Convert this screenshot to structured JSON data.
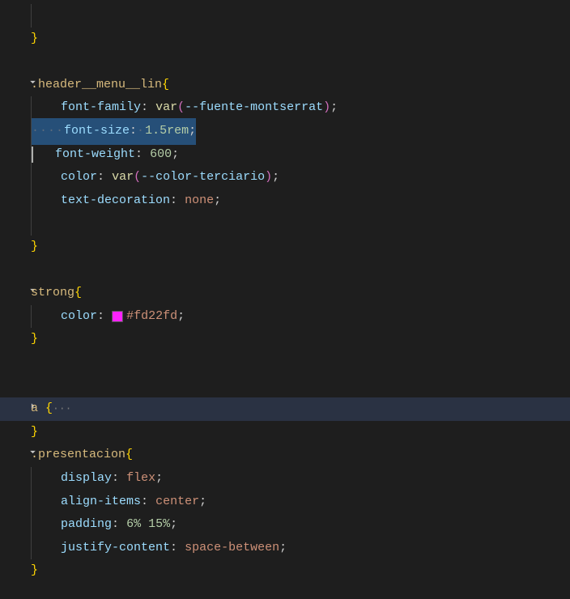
{
  "rules": {
    "headerMenuLin": {
      "selector": ".header__menu__lin",
      "props": {
        "fontFamily": {
          "name": "font-family",
          "func": "var",
          "arg": "--fuente-montserrat"
        },
        "fontSize": {
          "name": "font-size",
          "value": "1.5rem",
          "raw": "font-size: 1.5rem;"
        },
        "fontWeight": {
          "name": "font-weight",
          "value": "600"
        },
        "color": {
          "name": "color",
          "func": "var",
          "arg": "--color-terciario"
        },
        "textDecoration": {
          "name": "text-decoration",
          "value": "none"
        }
      }
    },
    "strong": {
      "selector": "strong",
      "props": {
        "color": {
          "name": "color",
          "value": "#fd22fd"
        }
      }
    },
    "a": {
      "selector": "a"
    },
    "presentacion": {
      "selector": ".presentacion",
      "props": {
        "display": {
          "name": "display",
          "value": "flex"
        },
        "alignItems": {
          "name": "align-items",
          "value": "center"
        },
        "padding": {
          "name": "padding",
          "value": "6% 15%"
        },
        "justifyContent": {
          "name": "justify-content",
          "value": "space-between"
        }
      }
    }
  },
  "folded": {
    "ellipsis": "···"
  },
  "braces": {
    "open": "{",
    "close": "}"
  },
  "punct": {
    "colon": ":",
    "semi": ";",
    "space": " "
  },
  "whitespace": {
    "dots": "····"
  },
  "swatch": {
    "color": "#fd22fd"
  }
}
